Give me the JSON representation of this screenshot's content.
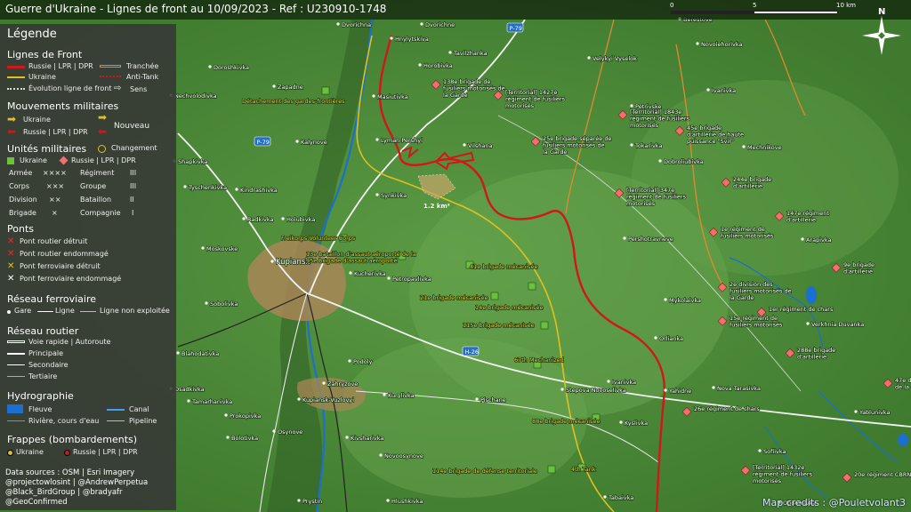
{
  "title": "Guerre d'Ukraine - Lignes de front au 10/09/2023 - Ref : U230910-1748",
  "scale": {
    "labels": [
      "0",
      "5",
      "10 km"
    ]
  },
  "north_label": "N",
  "credit": "Map credits : @Pouletvolant3",
  "colors": {
    "russia_front": "#d01818",
    "ukraine_front": "#e0c020",
    "legend_bg": "#373737",
    "road_primary": "#ffffff",
    "water": "#1a6fd0"
  },
  "legend": {
    "title": "Légende",
    "front_lines": {
      "heading": "Lignes de Front",
      "russia": "Russie | LPR | DPR",
      "ukraine": "Ukraine",
      "evolution": "Évolution ligne de front",
      "trench": "Tranchée",
      "antitank": "Anti-Tank",
      "direction": "Sens"
    },
    "movements": {
      "heading": "Mouvements militaires",
      "ukraine": "Ukraine",
      "russia": "Russie | LPR | DPR",
      "new": "Nouveau"
    },
    "units": {
      "heading": "Unités militaires",
      "change": "Changement",
      "ukraine": "Ukraine",
      "russia": "Russie | LPR | DPR",
      "sizes": [
        {
          "name": "Armée",
          "sym": "××××",
          "name2": "Régiment",
          "sym2": "III"
        },
        {
          "name": "Corps",
          "sym": "×××",
          "name2": "Groupe",
          "sym2": "III"
        },
        {
          "name": "Division",
          "sym": "××",
          "name2": "Bataillon",
          "sym2": "II"
        },
        {
          "name": "Brigade",
          "sym": "×",
          "name2": "Compagnie",
          "sym2": "I"
        }
      ]
    },
    "bridges": {
      "heading": "Ponts",
      "items": [
        "Pont routier détruit",
        "Pont routier endommagé",
        "Pont ferroviaire détruit",
        "Pont ferroviaire endommagé"
      ]
    },
    "rail": {
      "heading": "Réseau ferroviaire",
      "station": "Gare",
      "line": "Ligne",
      "unused": "Ligne non exploitée"
    },
    "roads": {
      "heading": "Réseau routier",
      "items": [
        "Voie rapide | Autoroute",
        "Principale",
        "Secondaire",
        "Tertiaire"
      ]
    },
    "hydro": {
      "heading": "Hydrographie",
      "river": "Fleuve",
      "canal": "Canal",
      "stream": "Rivière, cours d'eau",
      "pipeline": "Pipeline"
    },
    "strikes": {
      "heading": "Frappes (bombardements)",
      "ukraine": "Ukraine",
      "russia": "Russie | LPR | DPR"
    },
    "sources": [
      "Data sources : OSM | Esri Imagery",
      "@projectowlosint | @AndrewPerpetua",
      "@Black_BirdGroup | @bradyafr",
      "@GeoConfirmed"
    ]
  },
  "towns": [
    "Dvorichna",
    "Dvorichne",
    "Hnylytskiva",
    "Tavilzhanka",
    "Berestove",
    "Novoiehorivka",
    "Velykyi Vyselok",
    "Doroshkivka",
    "Horobivka",
    "Zapadne",
    "Masiutivka",
    "Ivanivka",
    "Nechvolodivka",
    "Petrivske",
    "Kalynove",
    "Lyman Pershyi",
    "Vilshana",
    "Tokarivka",
    "Mechnikove",
    "Shapkivka",
    "Dobroliubivka",
    "Tyschenkivka",
    "Kindrashivka",
    "Synkivka",
    "Radkivka",
    "Holubivka",
    "Pershotravneve",
    "Arapivka",
    "Moskovske",
    "Kucherivka",
    "Petropavlivka",
    "Kupiansk",
    "Sobolivka",
    "Mykolaivka",
    "Verkhnia Duvanka",
    "Orlianka",
    "Podoly",
    "Blahodativka",
    "Zahryzove",
    "Ivanivka",
    "Stepova Novoselivka",
    "Nova Tarasivka",
    "Osadkivka",
    "Tamarhanivka",
    "Kurylivka",
    "Kupiansk-Vuzlovyi",
    "Pischane",
    "Yahidne",
    "Yablunivka",
    "Prokopivka",
    "Bolotivka",
    "Osynove",
    "Kyslivka",
    "Kivsharivka",
    "Sofiivka",
    "Novoosynove",
    "Tabaivka",
    "Prystin",
    "Hlushkivka",
    "Oboronivka"
  ],
  "roads": [
    "P-79",
    "P-79",
    "H-26"
  ],
  "russia_units": [
    "138e brigade de fusiliers motorisés de la Garde",
    "[Territorial] 1427e régiment de fusiliers motorisés",
    "[Territorial] 1843e régiment de fusiliers motorisés",
    "45e brigade d'artillerie de haute puissance \"Svir\"",
    "25e brigade séparée de fusiliers motorisés de la Garde",
    "244e brigade d'artillerie",
    "[Territorial] 347e régiment de fusiliers motorisés",
    "147e régiment d'artillerie",
    "1e régiment de fusiliers motorisés",
    "9e brigade d'artillerie",
    "2e division des fusiliers motorisés de la Garde",
    "1er régiment de chars",
    "15e régiment de fusiliers motorisés",
    "288e brigade d'artillerie",
    "47e division de chars de la Garde",
    "26e régiment de chars",
    "[Territorial] 1432e régiment de fusiliers motorisés",
    "20e régiment CBRN"
  ],
  "ukraine_units": [
    "Détachement des gardes-frontières",
    "Freikorps Volunteer Corps",
    "13e bataillon d'assaut aéroporté de la 95e brigade d'assaut aéroporté",
    "41e brigade mécanisée",
    "21e brigade mécanisée",
    "14e brigade mécanisée",
    "115e brigade mécanisée",
    "67th Mechanized",
    "88e brigade mécanisée",
    "4th Tank",
    "114e brigade de défense territoriale"
  ],
  "area_label": "1.2 km²"
}
